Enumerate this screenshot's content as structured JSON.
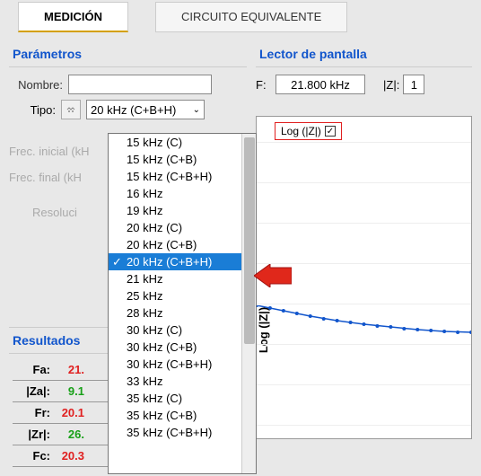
{
  "tabs": {
    "measurement": "MEDICIÓN",
    "circuit": "CIRCUITO EQUIVALENTE"
  },
  "params": {
    "title": "Parámetros",
    "name_label": "Nombre:",
    "name_value": "",
    "type_label": "Tipo:",
    "type_selected": "20 kHz (C+B+H)",
    "freq_initial_label": "Frec. inicial (kH",
    "freq_final_label": "Frec. final (kH",
    "resolution_label": "Resoluci"
  },
  "dropdown": {
    "options": [
      "15 kHz (C)",
      "15 kHz (C+B)",
      "15 kHz (C+B+H)",
      "16 kHz",
      "19 kHz",
      "20 kHz (C)",
      "20 kHz (C+B)",
      "20 kHz (C+B+H)",
      "21 kHz",
      "25 kHz",
      "28 kHz",
      "30 kHz (C)",
      "30 kHz (C+B)",
      "30 kHz (C+B+H)",
      "33 kHz",
      "35 kHz (C)",
      "35 kHz (C+B)",
      "35 kHz (C+B+H)"
    ],
    "selected_index": 7
  },
  "results": {
    "title": "Resultados",
    "rows": [
      {
        "label": "Fa:",
        "value": "21.",
        "color": "red"
      },
      {
        "label": "|Za|:",
        "value": "9.1",
        "color": "green"
      },
      {
        "label": "Fr:",
        "value": "20.1",
        "color": "red"
      },
      {
        "label": "|Zr|:",
        "value": "26.",
        "color": "green"
      },
      {
        "label": "Fc:",
        "value": "20.3",
        "color": "red"
      }
    ]
  },
  "screen": {
    "title": "Lector de pantalla",
    "f_label": "F:",
    "f_value": "21.800 kHz",
    "z_label": "|Z|:",
    "z_value": "1"
  },
  "plot": {
    "legend_label": "Log (|Z|)",
    "legend_checked": true,
    "y_axis_label": "Log (|Z|)"
  }
}
